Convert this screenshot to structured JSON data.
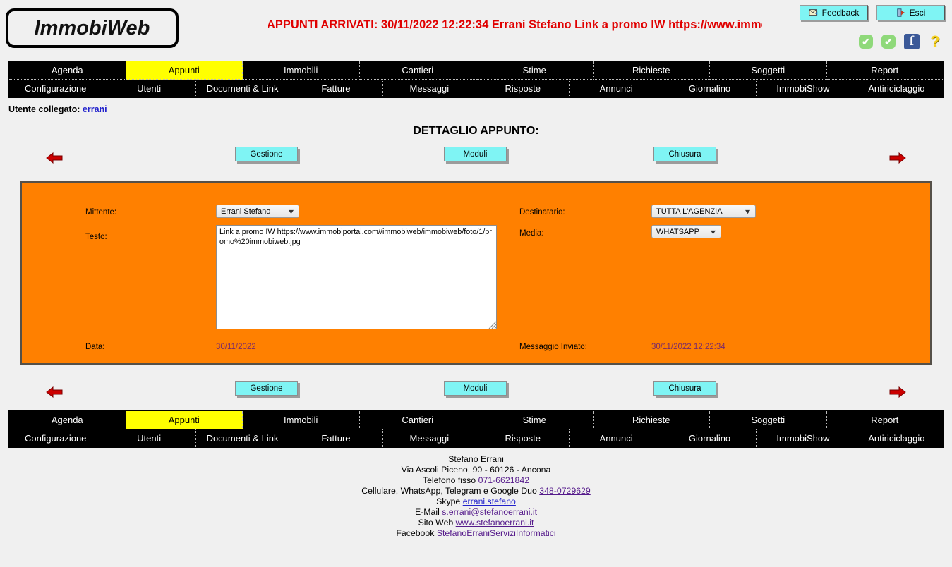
{
  "header": {
    "logo": "ImmobiWeb",
    "marquee": "APPUNTI ARRIVATI: 30/11/2022 12:22:34 Errani Stefano Link a promo IW https://www.immobiportal.com",
    "feedback_label": "Feedback",
    "esci_label": "Esci",
    "feedback_icon": "mail-icon",
    "esci_icon": "exit-door-icon",
    "status": {
      "check1": "✔",
      "check2": "✔",
      "facebook": "f",
      "help": "?"
    }
  },
  "nav": {
    "row1": [
      {
        "label": "Agenda",
        "active": false
      },
      {
        "label": "Appunti",
        "active": true
      },
      {
        "label": "Immobili",
        "active": false
      },
      {
        "label": "Cantieri",
        "active": false
      },
      {
        "label": "Stime",
        "active": false
      },
      {
        "label": "Richieste",
        "active": false
      },
      {
        "label": "Soggetti",
        "active": false
      },
      {
        "label": "Report",
        "active": false
      }
    ],
    "row2": [
      {
        "label": "Configurazione",
        "active": false
      },
      {
        "label": "Utenti",
        "active": false
      },
      {
        "label": "Documenti & Link",
        "active": false
      },
      {
        "label": "Fatture",
        "active": false
      },
      {
        "label": "Messaggi",
        "active": false
      },
      {
        "label": "Risposte",
        "active": false
      },
      {
        "label": "Annunci",
        "active": false
      },
      {
        "label": "Giornalino",
        "active": false
      },
      {
        "label": "ImmobiShow",
        "active": false
      },
      {
        "label": "Antiriciclaggio",
        "active": false
      }
    ]
  },
  "user": {
    "prefix": "Utente collegato:",
    "name": "errani"
  },
  "main": {
    "title": "DETTAGLIO APPUNTO:",
    "buttons": {
      "gestione": "Gestione",
      "moduli": "Moduli",
      "chiusura": "Chiusura"
    },
    "arrows": {
      "prev": "arrow-left-icon",
      "next": "arrow-right-icon"
    },
    "form": {
      "mittente_label": "Mittente:",
      "mittente_value": "Errani Stefano",
      "destinatario_label": "Destinatario:",
      "destinatario_value": "TUTTA L'AGENZIA",
      "testo_label": "Testo:",
      "testo_value": "Link a promo IW https://www.immobiportal.com//immobiweb/immobiweb/foto/1/promo%20immobiweb.jpg",
      "media_label": "Media:",
      "media_value": "WHATSAPP",
      "data_label": "Data:",
      "data_value": "30/11/2022",
      "inviato_label": "Messaggio Inviato:",
      "inviato_value": "30/11/2022 12:22:34"
    }
  },
  "footer": {
    "name": "Stefano Errani",
    "address": "Via Ascoli Piceno, 90 - 60126 - Ancona",
    "phone_label": "Telefono fisso",
    "phone_value": "071-6621842",
    "mobile_label": "Cellulare, WhatsApp, Telegram e Google Duo",
    "mobile_value": "348-0729629",
    "skype_label": "Skype",
    "skype_value": "errani.stefano",
    "email_label": "E-Mail",
    "email_value": "s.errani@stefanoerrani.it",
    "web_label": "Sito Web",
    "web_value": "www.stefanoerrani.it",
    "facebook_label": "Facebook",
    "facebook_value": "StefanoErraniServiziInformatici"
  },
  "colors": {
    "panel_bg": "#ff8000",
    "accent_cyan": "#7ff4f4",
    "nav_active": "#ffff00",
    "marquee_red": "#e00000"
  }
}
